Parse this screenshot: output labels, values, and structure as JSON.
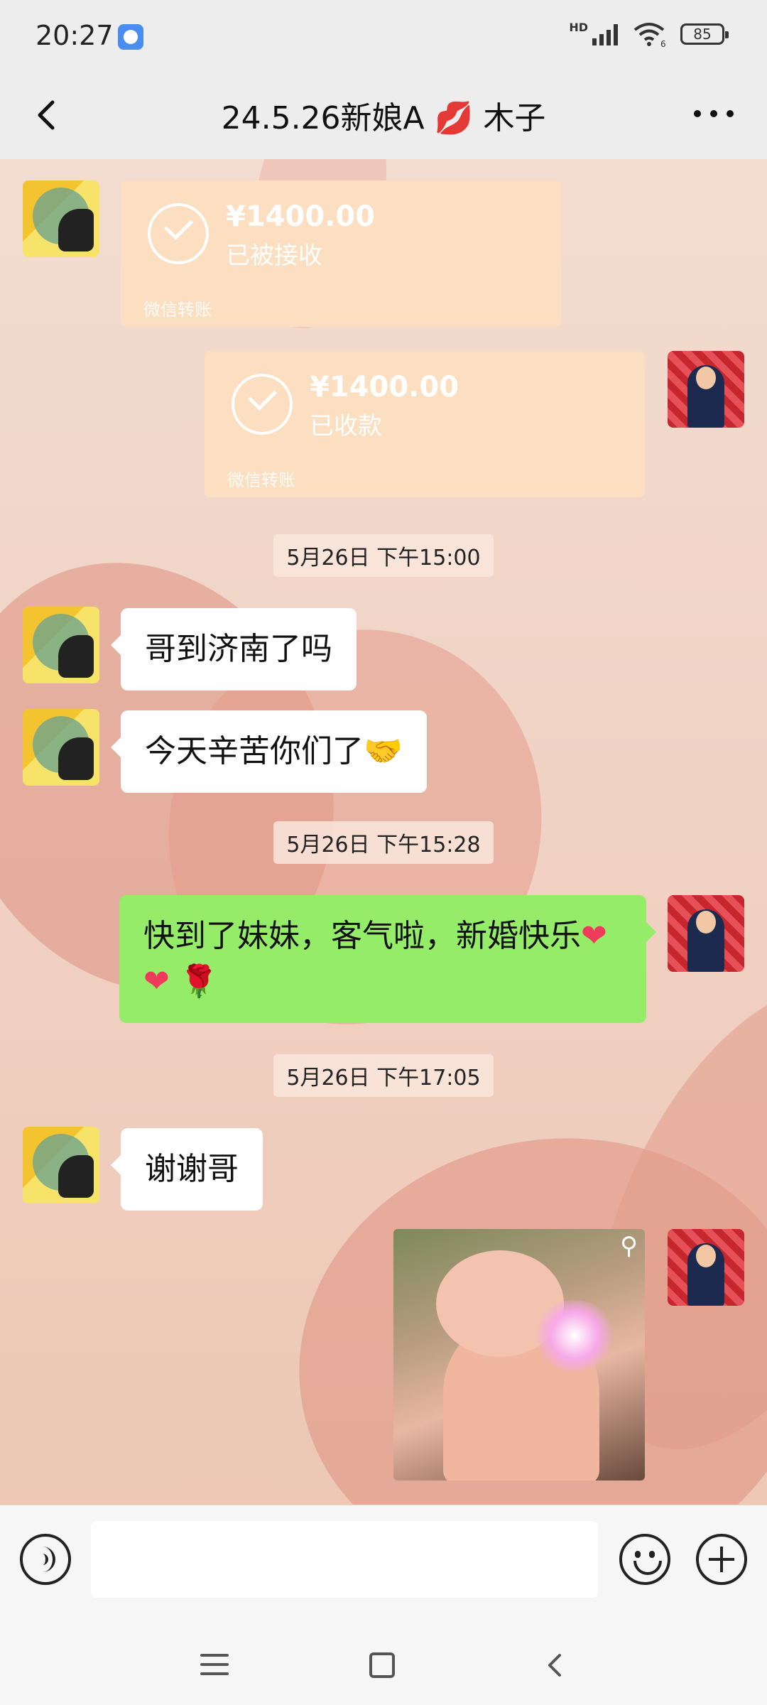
{
  "status_bar": {
    "time": "20:27",
    "network_label": "HD",
    "wifi_sub": "6",
    "battery": "85"
  },
  "header": {
    "title": "24.5.26新娘A 💋 木子"
  },
  "messages": {
    "transfer1": {
      "amount": "¥1400.00",
      "status": "已被接收",
      "footer": "微信转账"
    },
    "transfer2": {
      "amount": "¥1400.00",
      "status": "已收款",
      "footer": "微信转账"
    },
    "ts1": "5月26日 下午15:00",
    "m1": "哥到济南了吗",
    "m2": "今天辛苦你们了🤝",
    "ts2": "5月26日 下午15:28",
    "m3_text": "快到了妹妹，客气啦，新婚快乐",
    "m3_heart1": "❤",
    "m3_heart2": "❤",
    "m3_rose": "🌹",
    "ts3": "5月26日 下午17:05",
    "m4": "谢谢哥"
  },
  "input": {
    "placeholder": ""
  },
  "colors": {
    "outgoing_bubble": "#95ec69",
    "incoming_bubble": "#ffffff",
    "transfer_card": "#fcdfc0"
  }
}
